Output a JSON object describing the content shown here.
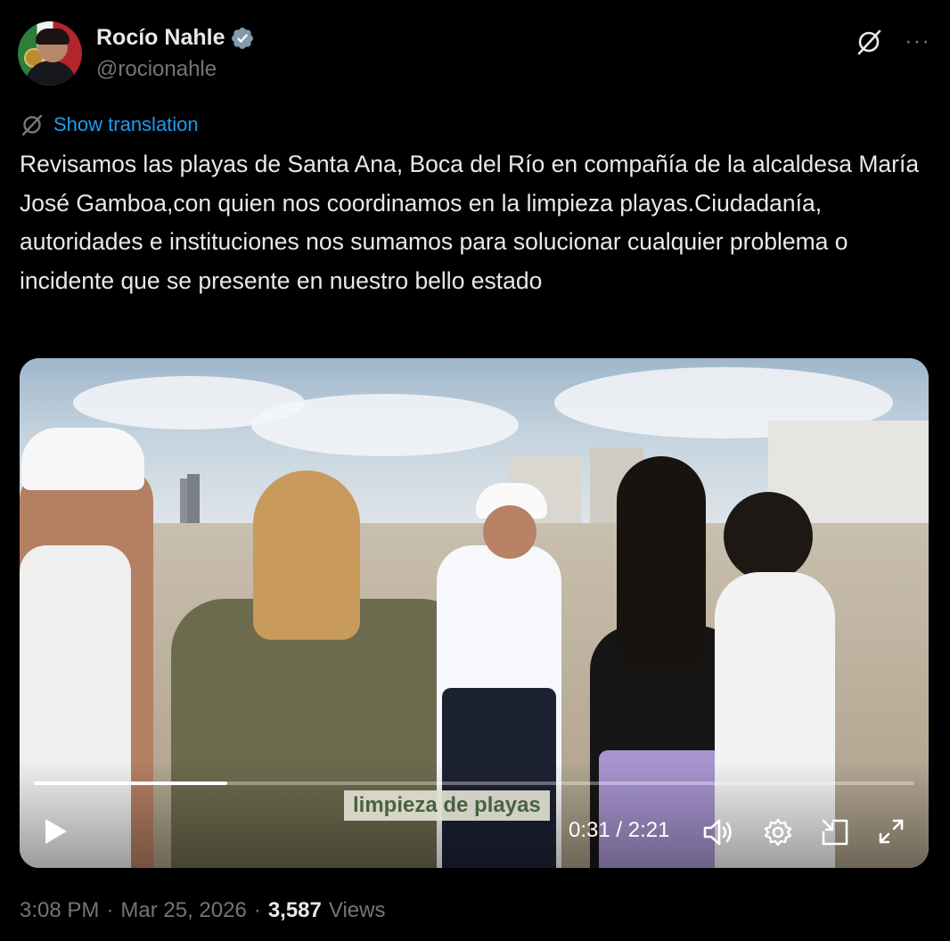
{
  "author": {
    "name": "Rocío Nahle",
    "handle": "@rocionahle",
    "verified_badge_color": "#1d9bf0",
    "avatar_icon": "profile-photo"
  },
  "header_icons": {
    "grok": "grok-icon",
    "more": "···"
  },
  "translation": {
    "label": "Show translation"
  },
  "tweet": {
    "text": "Revisamos las playas de Santa Ana, Boca del Río en compañía de la alcaldesa María José Gamboa,con quien nos coordinamos en la limpieza playas.Ciudadanía, autoridades e instituciones nos sumamos para solucionar cualquier problema o incidente que se presente en nuestro bello estado"
  },
  "video": {
    "caption": "limpieza de playas",
    "time": "0:31 / 2:21",
    "progress_fraction": 0.22
  },
  "meta": {
    "time": "3:08 PM",
    "sep1": "·",
    "date": "Mar 25, 2026",
    "sep2": "·",
    "views_count": "3,587",
    "views_label": "Views"
  },
  "colors": {
    "background": "#000000",
    "text_primary": "#e7e9ea",
    "text_secondary": "#71767b",
    "link": "#1d9bf0"
  }
}
